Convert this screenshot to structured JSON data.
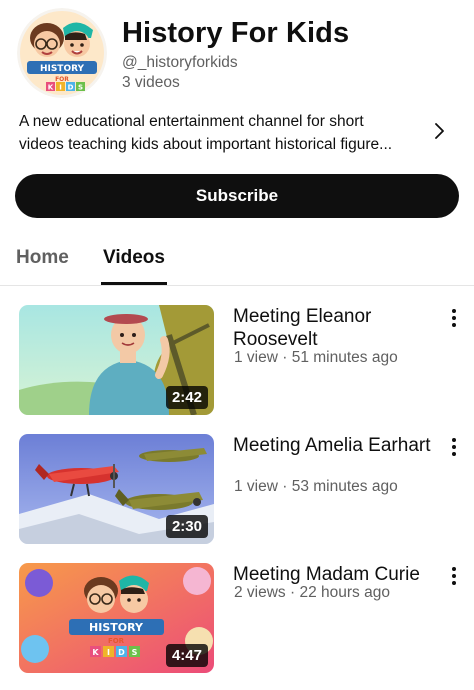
{
  "channel": {
    "name": "History For Kids",
    "handle": "@_historyforkids",
    "video_count": "3 videos",
    "description_line1": "A new educational entertainment channel for short",
    "description_line2": "videos teaching kids about important historical figure...",
    "avatar_logo_text": "HISTORY FOR KIDS"
  },
  "subscribe_label": "Subscribe",
  "tabs": [
    {
      "label": "Home",
      "active": false
    },
    {
      "label": "Videos",
      "active": true
    }
  ],
  "videos": [
    {
      "title": "Meeting Eleanor Roosevelt",
      "meta": "1 view · 51 minutes ago",
      "duration": "2:42"
    },
    {
      "title": "Meeting Amelia Earhart",
      "meta": "1 view · 53 minutes ago",
      "duration": "2:30"
    },
    {
      "title": "Meeting Madam Curie",
      "meta": "2 views · 22 hours ago",
      "duration": "4:47"
    }
  ],
  "icons": {
    "description_expand": "chevron-right-icon",
    "video_menu": "more-vertical-icon"
  }
}
